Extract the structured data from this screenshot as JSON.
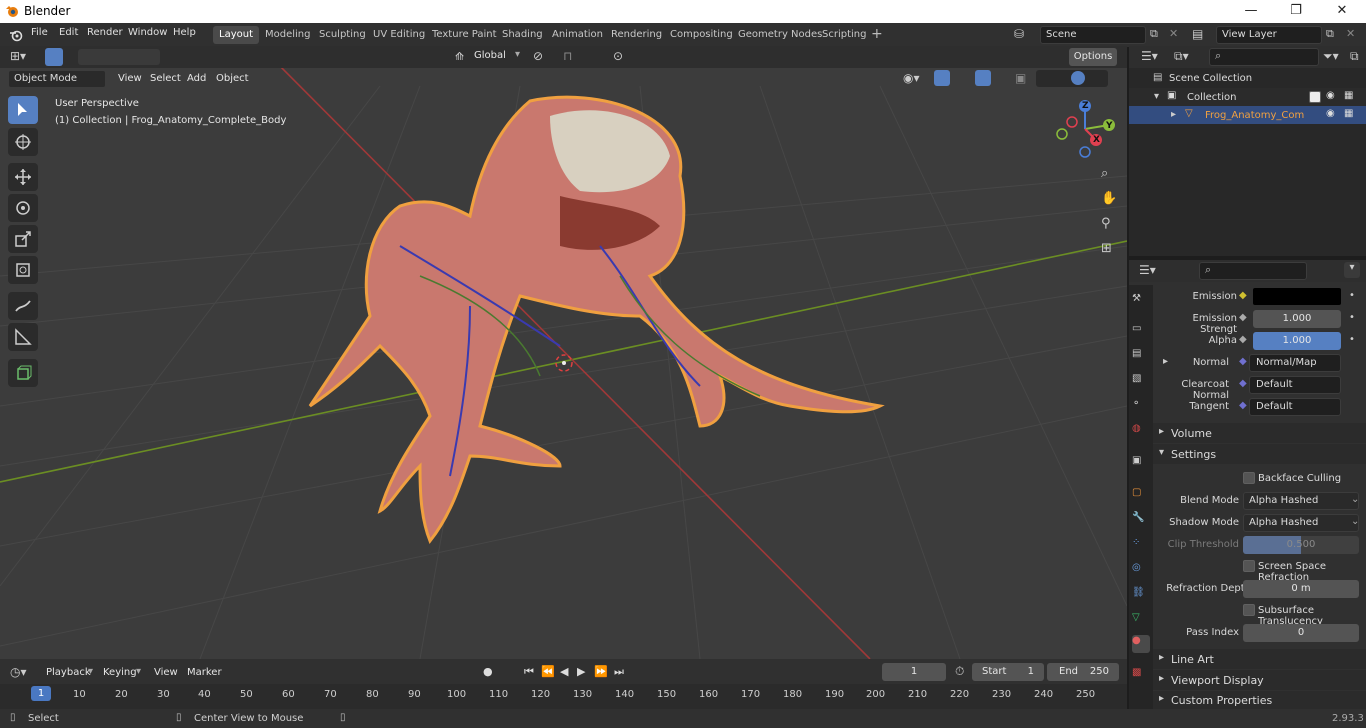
{
  "window": {
    "title": "Blender",
    "min": "—",
    "max": "❐",
    "close": "✕"
  },
  "menus": [
    "File",
    "Edit",
    "Render",
    "Window",
    "Help"
  ],
  "workspaces": [
    "Layout",
    "Modeling",
    "Sculpting",
    "UV Editing",
    "Texture Paint",
    "Shading",
    "Animation",
    "Rendering",
    "Compositing",
    "Geometry Nodes",
    "Scripting"
  ],
  "active_workspace": "Layout",
  "scene": {
    "name": "Scene",
    "view_layer": "View Layer"
  },
  "viewport": {
    "mode": "Object Mode",
    "menus": [
      "View",
      "Select",
      "Add",
      "Object"
    ],
    "transform_orientation": "Global",
    "options_label": "Options",
    "overlay_title": "User Perspective",
    "overlay_subtitle": "(1) Collection | Frog_Anatomy_Complete_Body",
    "gizmo": {
      "x": "X",
      "y": "Y",
      "z": "Z"
    }
  },
  "outliner": {
    "root": "Scene Collection",
    "collection": "Collection",
    "object": "Frog_Anatomy_Complete"
  },
  "properties": {
    "rows": [
      {
        "label": "Emission",
        "value": "",
        "color": "#000000"
      },
      {
        "label": "Emission Strengt",
        "value": "1.000"
      },
      {
        "label": "Alpha",
        "value": "1.000"
      },
      {
        "label": "Normal",
        "value": "Normal/Map"
      },
      {
        "label": "Clearcoat Normal",
        "value": "Default"
      },
      {
        "label": "Tangent",
        "value": "Default"
      }
    ],
    "volume": "Volume",
    "settings": "Settings",
    "backface": "Backface Culling",
    "blend_mode_label": "Blend Mode",
    "blend_mode": "Alpha Hashed",
    "shadow_mode_label": "Shadow Mode",
    "shadow_mode": "Alpha Hashed",
    "clip_label": "Clip Threshold",
    "clip_value": "0.500",
    "ssr": "Screen Space Refraction",
    "refraction_label": "Refraction Depth",
    "refraction_value": "0 m",
    "subsurface": "Subsurface Translucency",
    "pass_label": "Pass Index",
    "pass_value": "0",
    "line_art": "Line Art",
    "viewport_display": "Viewport Display",
    "custom_props": "Custom Properties"
  },
  "timeline": {
    "menus": [
      "Playback",
      "Keying",
      "View",
      "Marker"
    ],
    "current_frame": "1",
    "start_label": "Start",
    "start": "1",
    "end_label": "End",
    "end": "250",
    "ticks": [
      "1",
      "10",
      "20",
      "30",
      "40",
      "50",
      "60",
      "70",
      "80",
      "90",
      "100",
      "110",
      "120",
      "130",
      "140",
      "150",
      "160",
      "170",
      "180",
      "190",
      "200",
      "210",
      "220",
      "230",
      "240",
      "250"
    ]
  },
  "statusbar": {
    "select": "Select",
    "center": "Center View to Mouse",
    "version": "2.93.3"
  }
}
